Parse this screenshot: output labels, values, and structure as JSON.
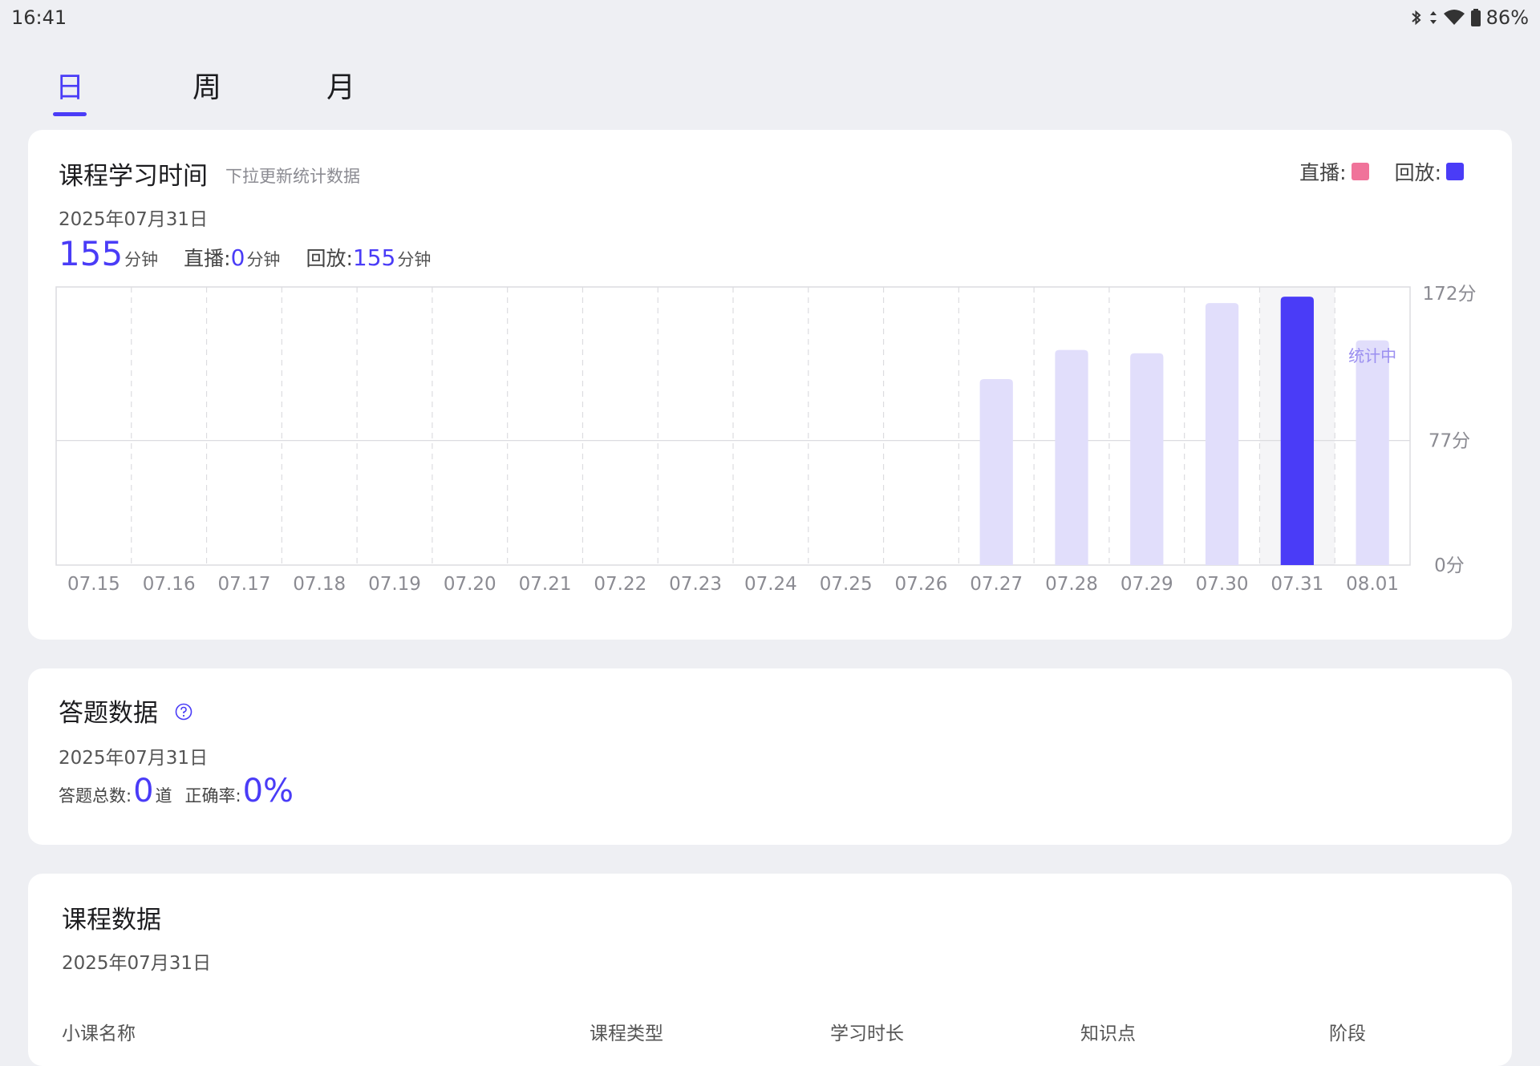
{
  "status_bar": {
    "time": "16:41",
    "battery": "86%"
  },
  "tabs": [
    {
      "label": "日",
      "active": true
    },
    {
      "label": "周",
      "active": false
    },
    {
      "label": "月",
      "active": false
    }
  ],
  "study_time": {
    "title": "课程学习时间",
    "subtitle": "下拉更新统计数据",
    "legend": [
      {
        "label": "直播:",
        "color": "#f0739a"
      },
      {
        "label": "回放:",
        "color": "#4a3cf7"
      }
    ],
    "date": "2025年07月31日",
    "total_value": "155",
    "total_unit": "分钟",
    "live_label": "直播:",
    "live_value": "0",
    "live_unit": "分钟",
    "replay_label": "回放:",
    "replay_value": "155",
    "replay_unit": "分钟"
  },
  "chart_data": {
    "type": "bar",
    "categories": [
      "07.15",
      "07.16",
      "07.17",
      "07.18",
      "07.19",
      "07.20",
      "07.21",
      "07.22",
      "07.23",
      "07.24",
      "07.25",
      "07.26",
      "07.27",
      "07.28",
      "07.29",
      "07.30",
      "07.31",
      "08.01"
    ],
    "values": [
      0,
      0,
      0,
      0,
      0,
      0,
      0,
      0,
      0,
      0,
      0,
      0,
      115,
      133,
      131,
      162,
      166,
      139
    ],
    "highlight_category": "07.31",
    "y_tick_labels": [
      "172分",
      "77分",
      "0分"
    ],
    "y_ticks": [
      172,
      77,
      0
    ],
    "ylim": [
      0,
      172
    ],
    "annotation": {
      "category": "08.01",
      "text": "统计中"
    },
    "colors": {
      "normal": "#e1defb",
      "highlight": "#4a3cf7",
      "annotation": "#9b8ff0"
    },
    "grid": true
  },
  "answer_data": {
    "title": "答题数据",
    "date": "2025年07月31日",
    "total_label": "答题总数:",
    "total_value": "0",
    "total_unit": "道",
    "accuracy_label": "正确率:",
    "accuracy_value": "0%"
  },
  "course_data": {
    "title": "课程数据",
    "date": "2025年07月31日",
    "columns": [
      "小课名称",
      "课程类型",
      "学习时长",
      "知识点",
      "阶段"
    ]
  }
}
